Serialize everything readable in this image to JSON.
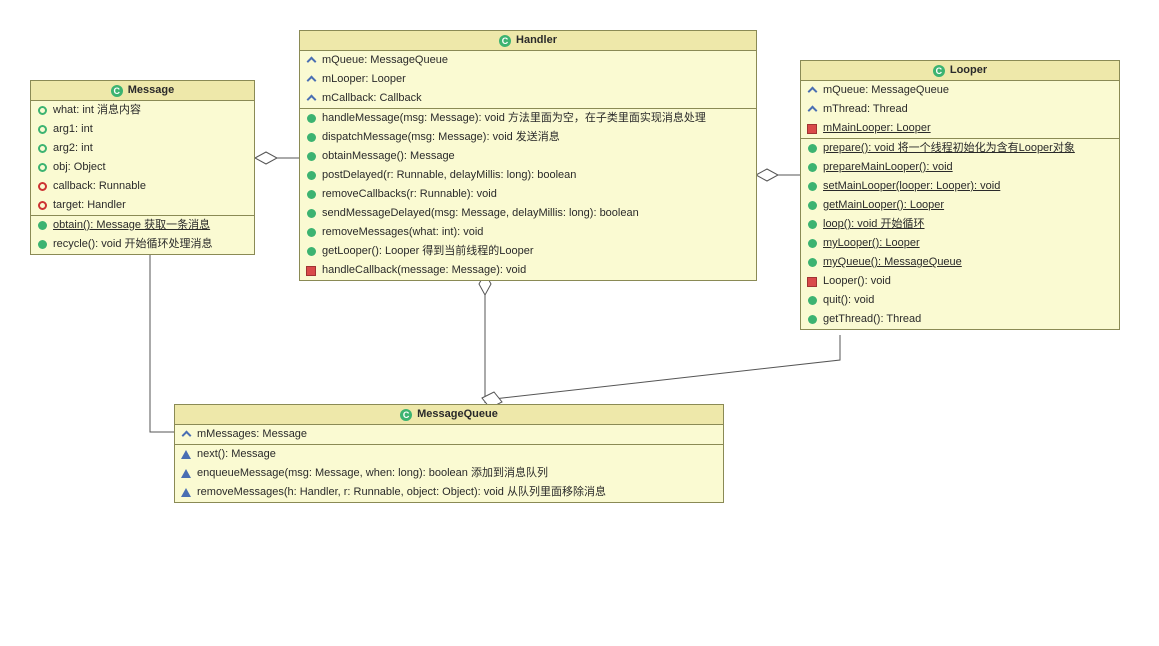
{
  "message": {
    "name": "Message",
    "attrs": [
      "what: int 消息内容",
      "arg1: int",
      "arg2: int",
      "obj: Object",
      "callback: Runnable",
      "target: Handler"
    ],
    "methods": [
      "obtain(): Message 获取一条消息",
      "recycle(): void 开始循环处理消息"
    ]
  },
  "handler": {
    "name": "Handler",
    "attrs": [
      "mQueue: MessageQueue",
      "mLooper: Looper",
      "mCallback: Callback"
    ],
    "methods": [
      "handleMessage(msg: Message): void 方法里面为空，在子类里面实现消息处理",
      "dispatchMessage(msg: Message): void 发送消息",
      "obtainMessage(): Message",
      "postDelayed(r: Runnable, delayMillis: long): boolean",
      "removeCallbacks(r: Runnable): void",
      "sendMessageDelayed(msg: Message, delayMillis: long): boolean",
      "removeMessages(what: int): void",
      "getLooper(): Looper 得到当前线程的Looper",
      "handleCallback(message: Message): void"
    ]
  },
  "looper": {
    "name": "Looper",
    "attrs": [
      "mQueue: MessageQueue",
      "mThread: Thread",
      "mMainLooper: Looper"
    ],
    "methods": [
      "prepare(): void 将一个线程初始化为含有Looper对象",
      "prepareMainLooper(): void",
      "setMainLooper(looper: Looper): void",
      "getMainLooper(): Looper",
      "loop(): void 开始循环",
      "myLooper(): Looper",
      "myQueue(): MessageQueue",
      "Looper(): void",
      "quit(): void",
      "getThread(): Thread"
    ]
  },
  "mqueue": {
    "name": "MessageQueue",
    "attrs": [
      "mMessages: Message"
    ],
    "methods": [
      "next(): Message",
      "enqueueMessage(msg: Message, when: long): boolean  添加到消息队列",
      "removeMessages(h: Handler, r: Runnable, object: Object): void 从队列里面移除消息"
    ]
  },
  "relations": [
    {
      "from": "Handler",
      "to": "Message",
      "type": "aggregation"
    },
    {
      "from": "Handler",
      "to": "Looper",
      "type": "aggregation"
    },
    {
      "from": "MessageQueue",
      "to": "Message",
      "type": "aggregation"
    },
    {
      "from": "MessageQueue",
      "to": "Handler",
      "type": "aggregation"
    },
    {
      "from": "MessageQueue",
      "to": "Looper",
      "type": "aggregation"
    }
  ]
}
